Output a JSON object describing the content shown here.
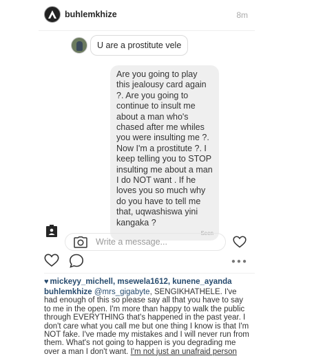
{
  "header": {
    "username": "buhlemkhize",
    "time": "8m"
  },
  "chat": {
    "incoming_message": "U are a prostitute vele",
    "outgoing_message": "Are you going to play this jealousy card again ?. Are you going to continue to insult me about a man who's chased after me whiles you were insulting me ?. Now I'm a prostitute ?. I keep telling you to STOP insulting me about a man I do NOT want . If he loves you so much why do you have to tell me that, uqwashiswa yini kangaka ?",
    "seen_label": "Seen"
  },
  "composer": {
    "placeholder": "Write a message..."
  },
  "post": {
    "likes": "mickeyy_michell, msewela1612, kunene_ayanda",
    "caption_user": "buhlemkhize",
    "caption_mention": "@mrs_gigabyte",
    "caption_text": ", SENGIKHATHELE. I've had enough of this so please say all that you have to say to me in the open. I'm more than happy to walk the public through EVERYTHING that's happened in the past year. I don't care what you call me but one thing I know is that I'm NOT fake. I've made my mistakes and I will never run from them. What's not going to happen is you degrading me over a man I don't want.",
    "caption_tail": "I'm not just an unafraid person"
  },
  "icons": {
    "header_avatar": "instagram-logo-avatar",
    "attach": "attachment-icon",
    "camera": "camera-icon",
    "heart": "heart-icon",
    "comment": "comment-icon",
    "more": "more-icon"
  }
}
